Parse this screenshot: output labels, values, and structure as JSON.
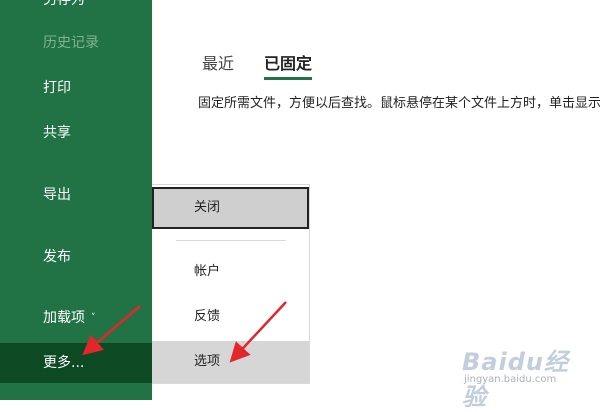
{
  "sidebar": {
    "items": [
      {
        "label": "另存为",
        "state": "normal"
      },
      {
        "label": "历史记录",
        "state": "disabled"
      },
      {
        "label": "打印",
        "state": "normal"
      },
      {
        "label": "共享",
        "state": "normal"
      },
      {
        "label": "导出",
        "state": "normal"
      },
      {
        "label": "发布",
        "state": "normal"
      },
      {
        "label": "加载项",
        "state": "normal",
        "chevron": "˅"
      },
      {
        "label": "更多...",
        "state": "selected"
      }
    ]
  },
  "main": {
    "tabs": [
      {
        "label": "最近",
        "active": false
      },
      {
        "label": "已固定",
        "active": true
      }
    ],
    "description": "固定所需文件，方便以后查找。鼠标悬停在某个文件上方时，单击显示的图钉图标。"
  },
  "menu": {
    "items": [
      {
        "label": "关闭",
        "state": "focused"
      },
      {
        "label": "帐户",
        "state": "normal"
      },
      {
        "label": "反馈",
        "state": "normal"
      },
      {
        "label": "选项",
        "state": "hover"
      }
    ]
  },
  "colors": {
    "sidebar_bg": "#217346",
    "sidebar_selected": "#0d4a24",
    "sidebar_disabled_text": "#7fb291",
    "tab_underline": "#217346",
    "annotation_arrow": "#e3262b",
    "menu_hover": "#d6d6d6"
  },
  "watermark": {
    "main": "Baidu经验",
    "sub": "jingyan.baidu.com"
  }
}
